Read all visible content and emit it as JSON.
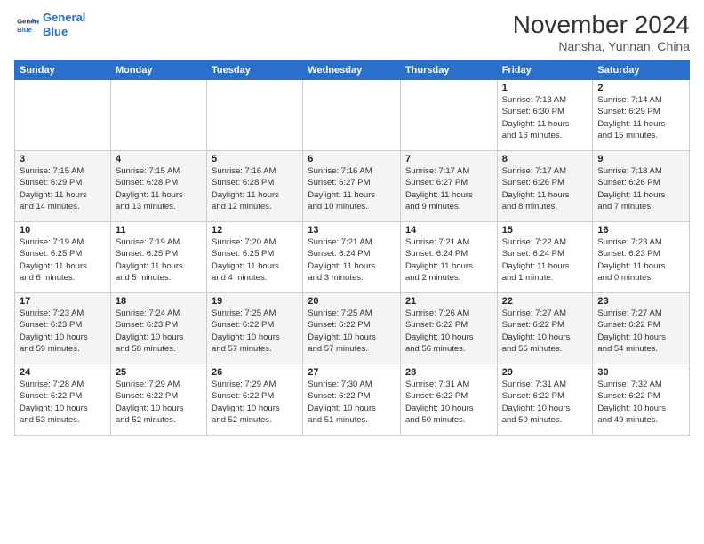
{
  "header": {
    "logo_line1": "General",
    "logo_line2": "Blue",
    "month_title": "November 2024",
    "location": "Nansha, Yunnan, China"
  },
  "days_of_week": [
    "Sunday",
    "Monday",
    "Tuesday",
    "Wednesday",
    "Thursday",
    "Friday",
    "Saturday"
  ],
  "weeks": [
    [
      {
        "day": "",
        "info": ""
      },
      {
        "day": "",
        "info": ""
      },
      {
        "day": "",
        "info": ""
      },
      {
        "day": "",
        "info": ""
      },
      {
        "day": "",
        "info": ""
      },
      {
        "day": "1",
        "info": "Sunrise: 7:13 AM\nSunset: 6:30 PM\nDaylight: 11 hours\nand 16 minutes."
      },
      {
        "day": "2",
        "info": "Sunrise: 7:14 AM\nSunset: 6:29 PM\nDaylight: 11 hours\nand 15 minutes."
      }
    ],
    [
      {
        "day": "3",
        "info": "Sunrise: 7:15 AM\nSunset: 6:29 PM\nDaylight: 11 hours\nand 14 minutes."
      },
      {
        "day": "4",
        "info": "Sunrise: 7:15 AM\nSunset: 6:28 PM\nDaylight: 11 hours\nand 13 minutes."
      },
      {
        "day": "5",
        "info": "Sunrise: 7:16 AM\nSunset: 6:28 PM\nDaylight: 11 hours\nand 12 minutes."
      },
      {
        "day": "6",
        "info": "Sunrise: 7:16 AM\nSunset: 6:27 PM\nDaylight: 11 hours\nand 10 minutes."
      },
      {
        "day": "7",
        "info": "Sunrise: 7:17 AM\nSunset: 6:27 PM\nDaylight: 11 hours\nand 9 minutes."
      },
      {
        "day": "8",
        "info": "Sunrise: 7:17 AM\nSunset: 6:26 PM\nDaylight: 11 hours\nand 8 minutes."
      },
      {
        "day": "9",
        "info": "Sunrise: 7:18 AM\nSunset: 6:26 PM\nDaylight: 11 hours\nand 7 minutes."
      }
    ],
    [
      {
        "day": "10",
        "info": "Sunrise: 7:19 AM\nSunset: 6:25 PM\nDaylight: 11 hours\nand 6 minutes."
      },
      {
        "day": "11",
        "info": "Sunrise: 7:19 AM\nSunset: 6:25 PM\nDaylight: 11 hours\nand 5 minutes."
      },
      {
        "day": "12",
        "info": "Sunrise: 7:20 AM\nSunset: 6:25 PM\nDaylight: 11 hours\nand 4 minutes."
      },
      {
        "day": "13",
        "info": "Sunrise: 7:21 AM\nSunset: 6:24 PM\nDaylight: 11 hours\nand 3 minutes."
      },
      {
        "day": "14",
        "info": "Sunrise: 7:21 AM\nSunset: 6:24 PM\nDaylight: 11 hours\nand 2 minutes."
      },
      {
        "day": "15",
        "info": "Sunrise: 7:22 AM\nSunset: 6:24 PM\nDaylight: 11 hours\nand 1 minute."
      },
      {
        "day": "16",
        "info": "Sunrise: 7:23 AM\nSunset: 6:23 PM\nDaylight: 11 hours\nand 0 minutes."
      }
    ],
    [
      {
        "day": "17",
        "info": "Sunrise: 7:23 AM\nSunset: 6:23 PM\nDaylight: 10 hours\nand 59 minutes."
      },
      {
        "day": "18",
        "info": "Sunrise: 7:24 AM\nSunset: 6:23 PM\nDaylight: 10 hours\nand 58 minutes."
      },
      {
        "day": "19",
        "info": "Sunrise: 7:25 AM\nSunset: 6:22 PM\nDaylight: 10 hours\nand 57 minutes."
      },
      {
        "day": "20",
        "info": "Sunrise: 7:25 AM\nSunset: 6:22 PM\nDaylight: 10 hours\nand 57 minutes."
      },
      {
        "day": "21",
        "info": "Sunrise: 7:26 AM\nSunset: 6:22 PM\nDaylight: 10 hours\nand 56 minutes."
      },
      {
        "day": "22",
        "info": "Sunrise: 7:27 AM\nSunset: 6:22 PM\nDaylight: 10 hours\nand 55 minutes."
      },
      {
        "day": "23",
        "info": "Sunrise: 7:27 AM\nSunset: 6:22 PM\nDaylight: 10 hours\nand 54 minutes."
      }
    ],
    [
      {
        "day": "24",
        "info": "Sunrise: 7:28 AM\nSunset: 6:22 PM\nDaylight: 10 hours\nand 53 minutes."
      },
      {
        "day": "25",
        "info": "Sunrise: 7:29 AM\nSunset: 6:22 PM\nDaylight: 10 hours\nand 52 minutes."
      },
      {
        "day": "26",
        "info": "Sunrise: 7:29 AM\nSunset: 6:22 PM\nDaylight: 10 hours\nand 52 minutes."
      },
      {
        "day": "27",
        "info": "Sunrise: 7:30 AM\nSunset: 6:22 PM\nDaylight: 10 hours\nand 51 minutes."
      },
      {
        "day": "28",
        "info": "Sunrise: 7:31 AM\nSunset: 6:22 PM\nDaylight: 10 hours\nand 50 minutes."
      },
      {
        "day": "29",
        "info": "Sunrise: 7:31 AM\nSunset: 6:22 PM\nDaylight: 10 hours\nand 50 minutes."
      },
      {
        "day": "30",
        "info": "Sunrise: 7:32 AM\nSunset: 6:22 PM\nDaylight: 10 hours\nand 49 minutes."
      }
    ]
  ]
}
